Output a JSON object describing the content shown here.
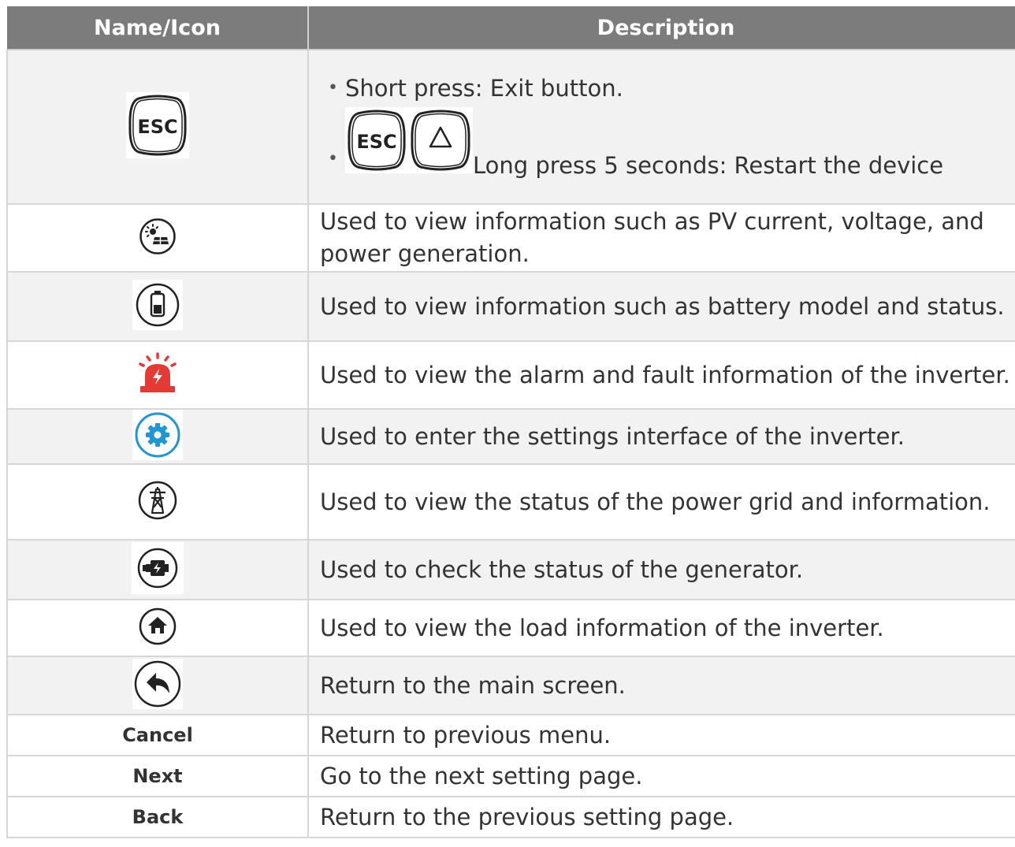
{
  "table": {
    "header": {
      "col_icon": "Name/Icon",
      "col_desc": "Description"
    },
    "esc_row": {
      "bullet_1": "Short press: Exit button.",
      "bullet_2": "Long press 5 seconds: Restart the device",
      "icon": "esc-key-icon",
      "combo_icons": [
        "esc-key-icon",
        "up-triangle-key-icon"
      ]
    },
    "rows": [
      {
        "icon": "pv-solar-icon",
        "description": "Used to view information such as PV current, voltage, and power generation."
      },
      {
        "icon": "battery-icon",
        "description": "Used to view information such as battery model and status."
      },
      {
        "icon": "alarm-icon",
        "description": "Used to view the alarm and fault information of the inverter."
      },
      {
        "icon": "settings-gear-icon",
        "description": "Used to enter the settings interface of the inverter."
      },
      {
        "icon": "power-grid-tower-icon",
        "description": "Used to view the status of the power grid and information."
      },
      {
        "icon": "generator-icon",
        "description": "Used to check the status of the generator."
      },
      {
        "icon": "home-load-icon",
        "description": "Used to view the load information of the inverter."
      },
      {
        "icon": "return-arrow-icon",
        "description": "Return to the main screen."
      }
    ],
    "text_rows": [
      {
        "label": "Cancel",
        "description": "Return to previous menu."
      },
      {
        "label": "Next",
        "description": "Go to the next setting page."
      },
      {
        "label": "Back",
        "description": "Return to the previous setting page."
      }
    ]
  },
  "colors": {
    "header_bg": "#7c7c7c",
    "alarm": "#e53935",
    "settings": "#2196d3",
    "border": "#d6d6d6",
    "shade": "#f2f2f2"
  }
}
